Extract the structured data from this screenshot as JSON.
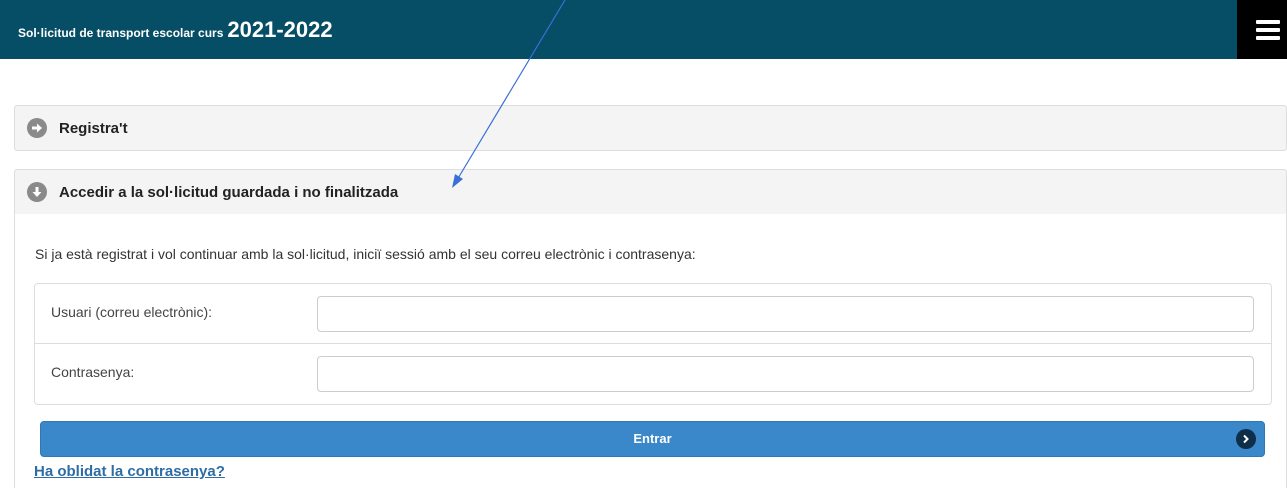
{
  "header": {
    "title_small": "Sol·licitud de transport escolar curs",
    "title_year": "2021-2022",
    "menu_icon": "hamburger-menu-icon"
  },
  "sections": {
    "register": {
      "label": "Registra't",
      "icon": "circle-arrow-right-icon"
    },
    "access": {
      "label": "Accedir a la sol·licitud guardada i no finalitzada",
      "icon": "circle-arrow-down-icon"
    }
  },
  "login": {
    "intro": "Si ja està registrat i vol continuar amb la sol·licitud, iniciï sessió amb el seu correu electrònic i contrasenya:",
    "user_label": "Usuari (correu electrònic):",
    "user_value": "",
    "password_label": "Contrasenya:",
    "password_value": "",
    "submit_label": "Entrar",
    "forgot_link": "Ha oblidat la contrasenya?"
  },
  "colors": {
    "header_bg": "#064e66",
    "button_bg": "#3a88c9",
    "link": "#2e6da4",
    "annotation_arrow": "#3a6fd8"
  }
}
